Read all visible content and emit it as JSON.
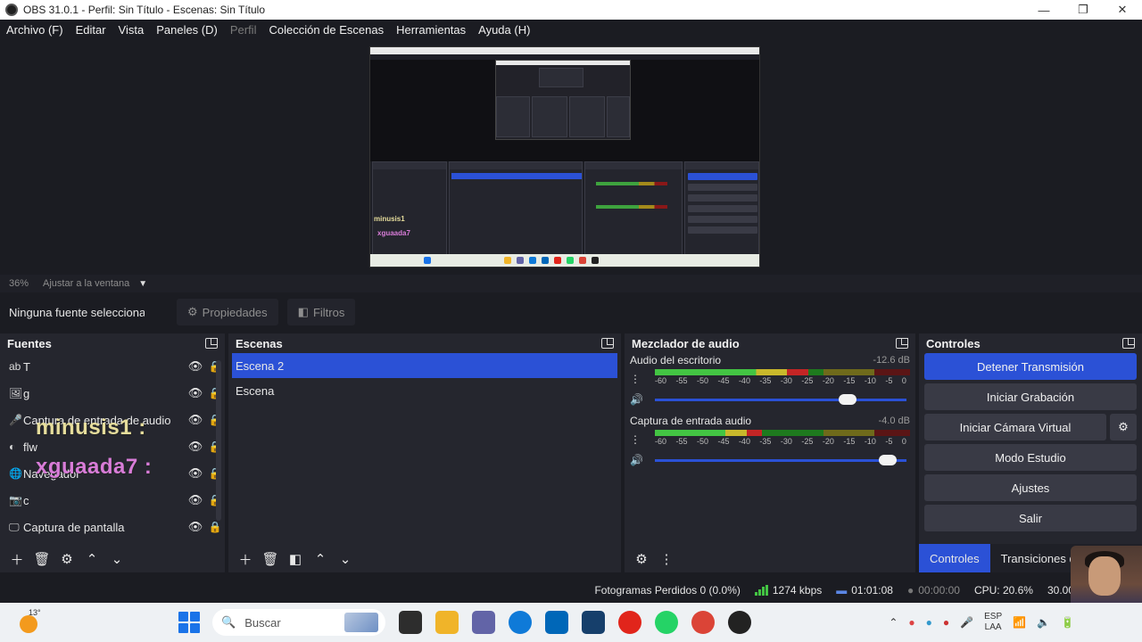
{
  "window": {
    "title": "OBS 31.0.1 - Perfil: Sin Título - Escenas: Sin Título",
    "minimize": "—",
    "maximize": "❐",
    "close": "✕"
  },
  "menu": [
    "Archivo (F)",
    "Editar",
    "Vista",
    "Paneles (D)",
    "Perfil",
    "Colección de Escenas",
    "Herramientas",
    "Ayuda (H)"
  ],
  "zoom_bar": {
    "zoom": "36%",
    "fit_label": "Ajustar a la ventana"
  },
  "source_toolbar": {
    "no_source": "Ninguna fuente seleccionada",
    "properties": "Propiedades",
    "filters": "Filtros"
  },
  "sources": {
    "title": "Fuentes",
    "items": [
      {
        "icon": "ab",
        "name": "T"
      },
      {
        "icon": "🖼",
        "name": "g"
      },
      {
        "icon": "🎤",
        "name": "Captura de entrada de audio"
      },
      {
        "icon": "◐",
        "name": "flw"
      },
      {
        "icon": "🌐",
        "name": "Navegador"
      },
      {
        "icon": "📷",
        "name": "c"
      },
      {
        "icon": "🖵",
        "name": "Captura de pantalla"
      }
    ],
    "overlays": [
      "minusis1 :",
      "xguaada7 :"
    ]
  },
  "scenes": {
    "title": "Escenas",
    "items": [
      "Escena 2",
      "Escena"
    ],
    "selected_index": 0
  },
  "mixer": {
    "title": "Mezclador de audio",
    "channels": [
      {
        "name": "Audio del escritorio",
        "db": "-12.6 dB",
        "level": 0.6,
        "volume": 0.8
      },
      {
        "name": "Captura de entrada audio",
        "db": "-4.0 dB",
        "level": 0.42,
        "volume": 0.96
      }
    ],
    "ticks": [
      "-60",
      "-55",
      "-50",
      "-45",
      "-40",
      "-35",
      "-30",
      "-25",
      "-20",
      "-15",
      "-10",
      "-5",
      "0"
    ]
  },
  "controls": {
    "title": "Controles",
    "stop_stream": "Detener Transmisión",
    "start_record": "Iniciar Grabación",
    "start_virtualcam": "Iniciar Cámara Virtual",
    "studio_mode": "Modo Estudio",
    "settings": "Ajustes",
    "exit": "Salir",
    "tabs": [
      "Controles",
      "Transiciones d"
    ]
  },
  "status": {
    "dropped": "Fotogramas Perdidos 0 (0.0%)",
    "bitrate": "1274 kbps",
    "stream_time": "01:01:08",
    "record_time": "00:00:00",
    "cpu": "CPU: 20.6%",
    "fps": "30.00"
  },
  "taskbar": {
    "temp": "13°",
    "search_placeholder": "Buscar",
    "lang_top": "ESP",
    "lang_bottom": "LAA"
  },
  "colors": {
    "accent": "#2b51d6",
    "panel": "#25262e",
    "background": "#1b1c22"
  }
}
